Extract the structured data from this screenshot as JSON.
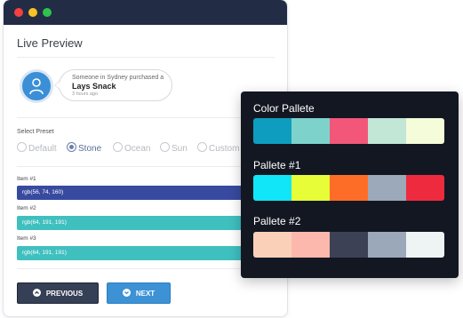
{
  "window": {
    "title": "Live Preview"
  },
  "notification": {
    "line1": "Someone in Sydney purchased a",
    "product": "Lays Snack",
    "time": "3 hours ago",
    "avatar_icon": "user-icon"
  },
  "preset": {
    "label": "Select Preset",
    "options": [
      "Default",
      "Stone",
      "Ocean",
      "Sun",
      "Custom"
    ],
    "selected": "Stone"
  },
  "items": [
    {
      "label": "Item #1",
      "value": "rgb(56, 74, 160)",
      "color": "#384aa0"
    },
    {
      "label": "Item #2",
      "value": "rgb(64, 191, 191)",
      "color": "#40bfbf"
    },
    {
      "label": "Item #3",
      "value": "rgb(64, 191, 191)",
      "color": "#40bfbf"
    }
  ],
  "buttons": {
    "previous": "PREVIOUS",
    "next": "NEXT"
  },
  "palettes": [
    {
      "title": "Color Pallete",
      "colors": [
        "#0e9dbe",
        "#7dd3cc",
        "#f2577a",
        "#c3e7d6",
        "#f5fcd9"
      ]
    },
    {
      "title": "Pallete #1",
      "colors": [
        "#11e5f8",
        "#e6fd37",
        "#fe6d28",
        "#9ba9bb",
        "#ee2b3e"
      ]
    },
    {
      "title": "Pallete #2",
      "colors": [
        "#fad0b9",
        "#fdb8ad",
        "#3c4155",
        "#9ba8ba",
        "#eef3f4"
      ]
    }
  ]
}
